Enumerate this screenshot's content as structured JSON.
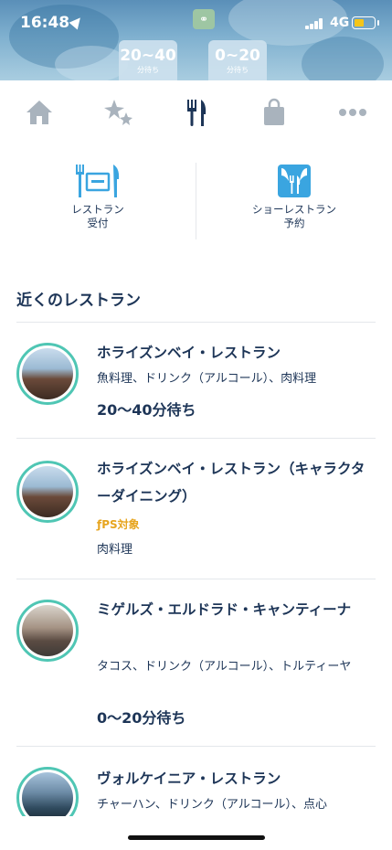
{
  "status_bar": {
    "time": "16:48",
    "network": "4G"
  },
  "map_header": {
    "badges": [
      {
        "value": "20~40",
        "sub": "分待ち"
      },
      {
        "value": "0~20",
        "sub": "分待ち"
      }
    ]
  },
  "tabs": [
    {
      "icon": "home-icon",
      "active": false
    },
    {
      "icon": "sparkles-icon",
      "active": false
    },
    {
      "icon": "fork-knife-icon",
      "active": true
    },
    {
      "icon": "shopping-bag-icon",
      "active": false
    },
    {
      "icon": "more-icon",
      "active": false
    }
  ],
  "quick_actions": [
    {
      "line1": "レストラン",
      "line2": "受付",
      "icon": "restaurant-reception-icon"
    },
    {
      "line1": "ショーレストラン",
      "line2": "予約",
      "icon": "show-restaurant-icon"
    }
  ],
  "section_title": "近くのレストラン",
  "restaurants": [
    {
      "name": "ホライズンベイ・レストラン",
      "tags": "魚料理、ドリンク（アルコール）、肉料理",
      "wait": "20〜40分待ち"
    },
    {
      "name": "ホライズンベイ・レストラン（キャラクターダイニング）",
      "ps": "PS対象",
      "tags": "肉料理"
    },
    {
      "name": "ミゲルズ・エルドラド・キャンティーナ",
      "tags": "タコス、ドリンク（アルコール）、トルティーヤ",
      "wait": "0〜20分待ち"
    },
    {
      "name": "ヴォルケイニア・レストラン",
      "tags": "チャーハン、ドリンク（アルコール）、点心"
    }
  ],
  "colors": {
    "navy": "#1d3557",
    "accent": "#3aa5e0",
    "ring": "#4fc6b4",
    "ps_gold": "#e7a51f"
  }
}
